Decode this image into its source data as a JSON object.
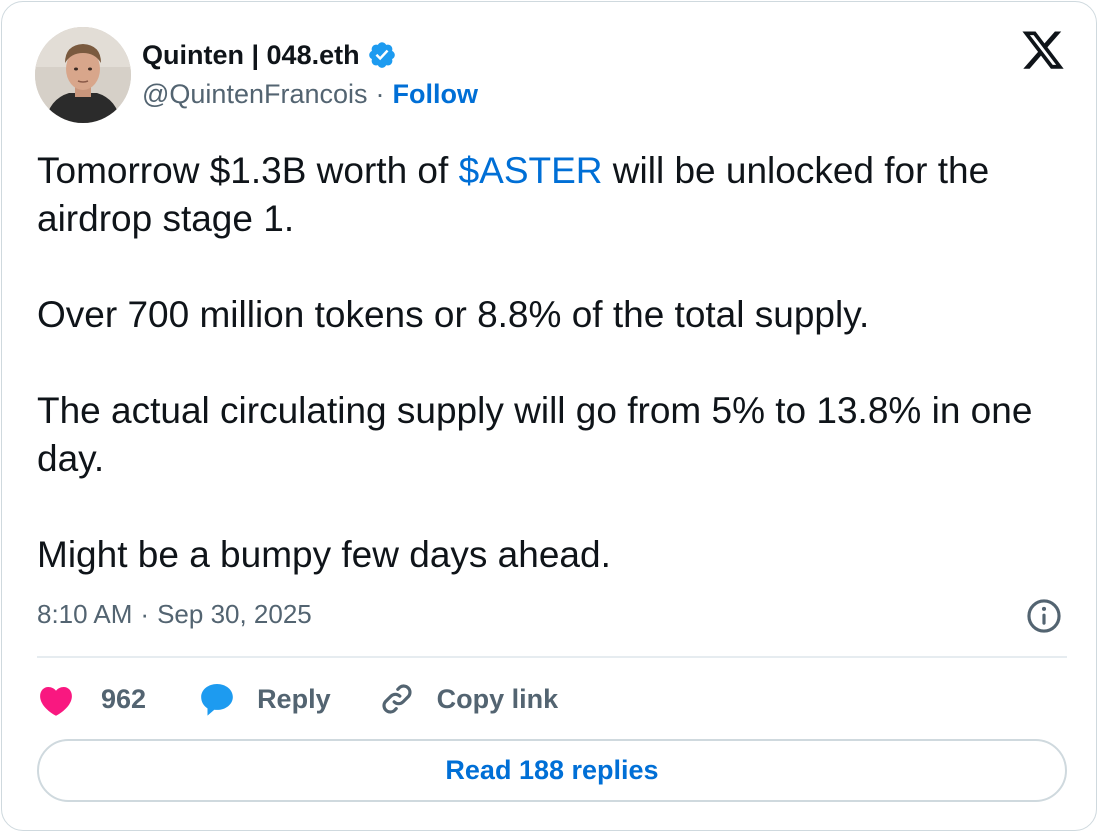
{
  "author": {
    "display_name": "Quinten | 048.eth",
    "handle": "@QuintenFrancois",
    "separator": "·",
    "follow_label": "Follow",
    "verified": true
  },
  "tweet": {
    "line1_before": "Tomorrow $1.3B worth of ",
    "line1_cashtag": "$ASTER",
    "line1_after": " will be unlocked for the airdrop stage 1.",
    "paragraph2": "Over 700 million tokens or 8.8% of the total supply.",
    "paragraph3": "The actual circulating supply will go from 5% to 13.8% in one day.",
    "paragraph4": "Might be a bumpy few days ahead."
  },
  "meta": {
    "time": "8:10 AM",
    "separator": "·",
    "date": "Sep 30, 2025"
  },
  "actions": {
    "like_count": "962",
    "reply_label": "Reply",
    "copy_link_label": "Copy link"
  },
  "read_replies_label": "Read 188 replies",
  "colors": {
    "accent": "#006fd6",
    "verified": "#1d9bf0",
    "like": "#f91880",
    "reply_icon": "#1d9bf0",
    "muted": "#536471",
    "border": "#cfd9de"
  },
  "icons": {
    "verified": "verified-badge-icon",
    "logo": "x-logo-icon",
    "info": "info-icon",
    "like": "heart-icon",
    "reply": "speech-bubble-icon",
    "copy": "link-icon"
  }
}
